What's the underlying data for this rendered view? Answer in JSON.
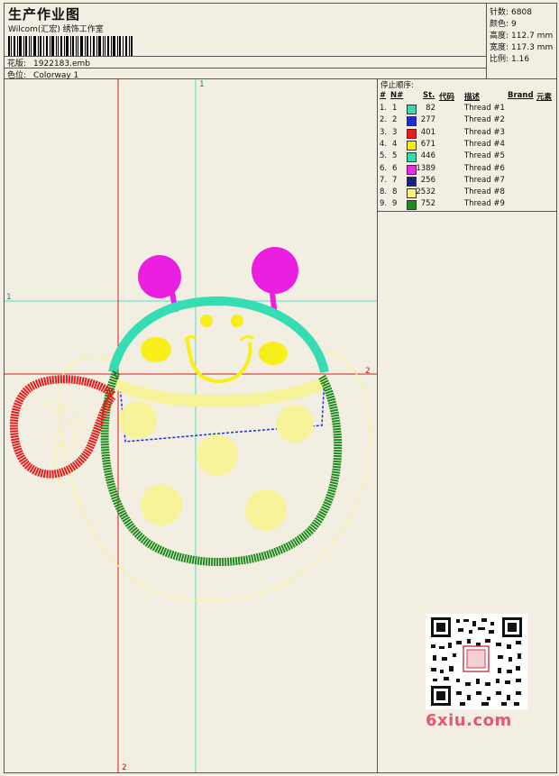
{
  "header": {
    "title": "生产作业图",
    "studio": "Wilcom(汇宏) 绣饰工作室",
    "design_label": "花版:",
    "design_value": "1922183.emb",
    "colorway_label": "色位:",
    "colorway_value": "Colorway 1"
  },
  "stats": [
    {
      "label": "针数:",
      "value": "6808"
    },
    {
      "label": "颜色:",
      "value": "9"
    },
    {
      "label": "高度:",
      "value": "112.7 mm"
    },
    {
      "label": "宽度:",
      "value": "117.3 mm"
    },
    {
      "label": "比例:",
      "value": "1.16"
    }
  ],
  "guides": {
    "cyan_top": "1",
    "cyan_left": "1",
    "red_right": "2",
    "red_bottom": "2"
  },
  "thread_panel": {
    "title": "停止顺序:",
    "headers": {
      "num": "#",
      "n": "N#",
      "st": "St.",
      "code": "代码",
      "desc": "描述",
      "brand": "Brand",
      "element": "元素"
    },
    "rows": [
      {
        "idx": "1.",
        "n": "1",
        "color": "#3cd9b0",
        "st": "82",
        "desc": "Thread #1"
      },
      {
        "idx": "2.",
        "n": "2",
        "color": "#1a2fd6",
        "st": "277",
        "desc": "Thread #2"
      },
      {
        "idx": "3.",
        "n": "3",
        "color": "#e81c1c",
        "st": "401",
        "desc": "Thread #3"
      },
      {
        "idx": "4.",
        "n": "4",
        "color": "#f5f00a",
        "st": "671",
        "desc": "Thread #4"
      },
      {
        "idx": "5.",
        "n": "5",
        "color": "#34d9ae",
        "st": "446",
        "desc": "Thread #5"
      },
      {
        "idx": "6.",
        "n": "6",
        "color": "#ea2ae0",
        "st": "1389",
        "desc": "Thread #6"
      },
      {
        "idx": "7.",
        "n": "7",
        "color": "#1a1f82",
        "st": "256",
        "desc": "Thread #7"
      },
      {
        "idx": "8.",
        "n": "8",
        "color": "#f7f28a",
        "st": "2532",
        "desc": "Thread #8"
      },
      {
        "idx": "9.",
        "n": "9",
        "color": "#1f8a1f",
        "st": "752",
        "desc": "Thread #9"
      }
    ]
  },
  "colors": {
    "magenta": "#ea1fe0",
    "cyan": "#36dcb4",
    "yellow": "#f7ee1a",
    "pale_yellow": "#f7f39a",
    "green": "#1c8a1c",
    "red": "#e81a1a",
    "blue": "#1c2fd6",
    "guide_red": "#e01818",
    "guide_cyan": "#58dcc4"
  },
  "watermark": "6xiu.com"
}
